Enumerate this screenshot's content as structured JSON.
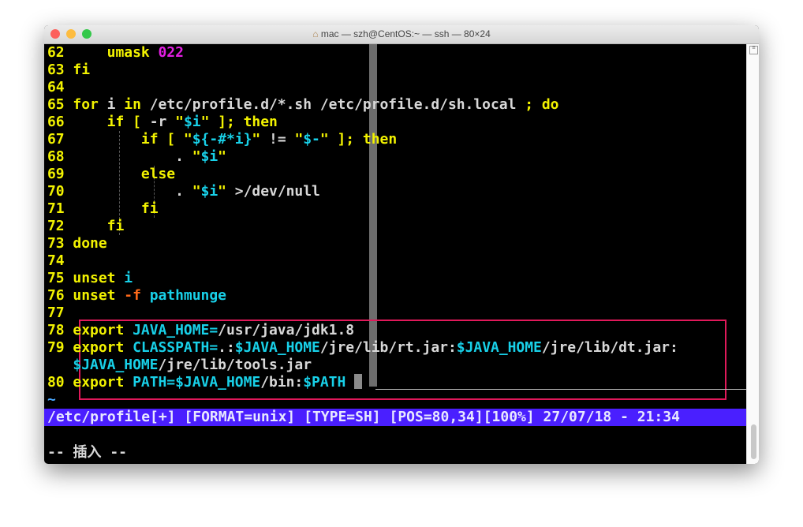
{
  "window": {
    "title": "mac — szh@CentOS:~ — ssh — 80×24",
    "title_icon": "home-icon",
    "buttons": {
      "close": "#fc605c",
      "minimize": "#fdbc40",
      "zoom": "#34c84a"
    }
  },
  "lines": [
    {
      "num": "62",
      "segs": [
        [
          "w",
          "    "
        ],
        [
          "y",
          "umask "
        ],
        [
          "m",
          "022"
        ]
      ]
    },
    {
      "num": "63",
      "segs": [
        [
          "y",
          "fi"
        ]
      ]
    },
    {
      "num": "64",
      "segs": []
    },
    {
      "num": "65",
      "segs": [
        [
          "y",
          "for "
        ],
        [
          "w",
          "i "
        ],
        [
          "y",
          "in "
        ],
        [
          "w",
          "/etc/profile.d/*.sh /etc/profile.d/sh.local "
        ],
        [
          "y",
          "; do"
        ]
      ]
    },
    {
      "num": "66",
      "segs": [
        [
          "w",
          "    "
        ],
        [
          "y",
          "if [ "
        ],
        [
          "w",
          "-r "
        ],
        [
          "y",
          "\""
        ],
        [
          "c",
          "$i"
        ],
        [
          "y",
          "\" ]; then"
        ]
      ]
    },
    {
      "num": "67",
      "segs": [
        [
          "w",
          "        "
        ],
        [
          "y",
          "if [ \""
        ],
        [
          "c",
          "${-#*i}"
        ],
        [
          "y",
          "\" "
        ],
        [
          "w",
          "!= "
        ],
        [
          "y",
          "\""
        ],
        [
          "c",
          "$-"
        ],
        [
          "y",
          "\" ]; then"
        ]
      ]
    },
    {
      "num": "68",
      "segs": [
        [
          "w",
          "            . "
        ],
        [
          "y",
          "\""
        ],
        [
          "c",
          "$i"
        ],
        [
          "y",
          "\""
        ]
      ]
    },
    {
      "num": "69",
      "segs": [
        [
          "w",
          "        "
        ],
        [
          "y",
          "else"
        ]
      ]
    },
    {
      "num": "70",
      "segs": [
        [
          "w",
          "            . "
        ],
        [
          "y",
          "\""
        ],
        [
          "c",
          "$i"
        ],
        [
          "y",
          "\" "
        ],
        [
          "w",
          ">/dev/null"
        ]
      ]
    },
    {
      "num": "71",
      "segs": [
        [
          "w",
          "        "
        ],
        [
          "y",
          "fi"
        ]
      ]
    },
    {
      "num": "72",
      "segs": [
        [
          "w",
          "    "
        ],
        [
          "y",
          "fi"
        ]
      ]
    },
    {
      "num": "73",
      "segs": [
        [
          "y",
          "done"
        ]
      ]
    },
    {
      "num": "74",
      "segs": []
    },
    {
      "num": "75",
      "segs": [
        [
          "y",
          "unset "
        ],
        [
          "c",
          "i"
        ]
      ]
    },
    {
      "num": "76",
      "segs": [
        [
          "y",
          "unset "
        ],
        [
          "o",
          "-f "
        ],
        [
          "c",
          "pathmunge"
        ]
      ]
    },
    {
      "num": "77",
      "segs": []
    },
    {
      "num": "78",
      "segs": [
        [
          "y",
          "export "
        ],
        [
          "c",
          "JAVA_HOME="
        ],
        [
          "w",
          "/usr/java/jdk1.8"
        ]
      ]
    },
    {
      "num": "79",
      "segs": [
        [
          "y",
          "export "
        ],
        [
          "c",
          "CLASSPATH="
        ],
        [
          "w",
          ".:"
        ],
        [
          "c",
          "$JAVA_HOME"
        ],
        [
          "w",
          "/jre/lib/rt.jar:"
        ],
        [
          "c",
          "$JAVA_HOME"
        ],
        [
          "w",
          "/jre/lib/dt.jar:"
        ]
      ]
    },
    {
      "num": "",
      "segs": [
        [
          "c",
          "$JAVA_HOME"
        ],
        [
          "w",
          "/jre/lib/tools.jar"
        ]
      ]
    },
    {
      "num": "80",
      "segs": [
        [
          "y",
          "export "
        ],
        [
          "c",
          "PATH="
        ],
        [
          "c",
          "$JAVA_HOME"
        ],
        [
          "w",
          "/bin:"
        ],
        [
          "c",
          "$PATH"
        ],
        [
          "w",
          " "
        ]
      ]
    },
    {
      "num": "~",
      "segs": []
    }
  ],
  "status_line": "/etc/profile[+] [FORMAT=unix] [TYPE=SH] [POS=80,34][100%] 27/07/18 - 21:34",
  "mode_line": "-- 插入 --",
  "highlight_color": "#e0195a"
}
